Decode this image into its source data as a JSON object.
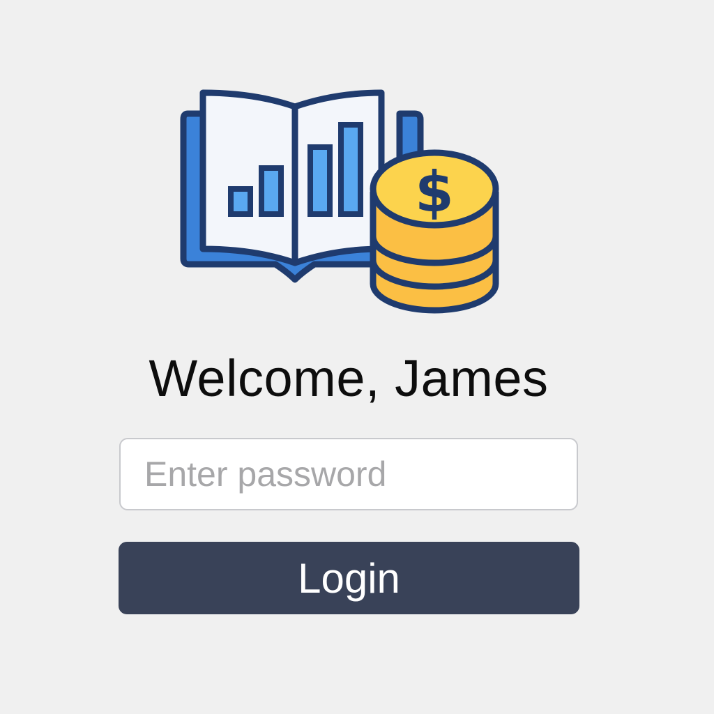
{
  "app": {
    "logo_icon": "book-chart-coins-icon",
    "colors": {
      "background": "#f0f0f0",
      "outline": "#1f3b6e",
      "book_blue": "#3b82d9",
      "page": "#f3f6fb",
      "coin": "#fbbf44",
      "coin_top": "#fcd34d"
    }
  },
  "login": {
    "welcome": "Welcome, James",
    "password_placeholder": "Enter password",
    "password_value": "",
    "button_label": "Login",
    "button_color": "#394258"
  }
}
